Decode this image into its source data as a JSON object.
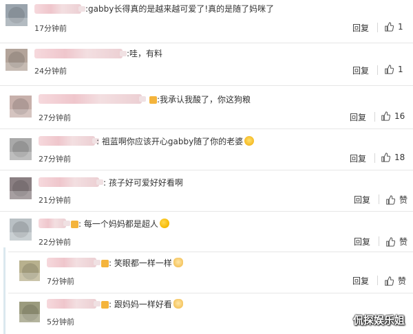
{
  "comments": [
    {
      "time": "17分钟前",
      "text": "gabby长得真的是越来越可爱了!真的是随了妈咪了",
      "reply": "回复",
      "likes": "1"
    },
    {
      "time": "24分钟前",
      "text": "哇，有料",
      "reply": "回复",
      "likes": "1"
    },
    {
      "time": "27分钟前",
      "text": "我承认我酸了，你这狗粮",
      "reply": "回复",
      "likes": "16"
    },
    {
      "time": "27分钟前",
      "text": "祖蓝啊你应该开心gabby随了你的老婆",
      "reply": "回复",
      "likes": "18"
    },
    {
      "time": "21分钟前",
      "text": "孩子好可爱好好看啊",
      "reply": "回复",
      "likes": "赞"
    },
    {
      "time": "22分钟前",
      "text": "每一个妈妈都是超人",
      "reply": "回复",
      "likes": "赞"
    },
    {
      "time": "7分钟前",
      "text": "笑眼都一样一样",
      "reply": "回复",
      "likes": "赞"
    },
    {
      "time": "5分钟前",
      "text": "跟妈妈一样好看",
      "reply": "回复",
      "likes": "赞"
    }
  ],
  "colon": ":",
  "watermark": "侃探娱乐姐",
  "icons": {
    "thumb": "thumbs-up-icon"
  }
}
